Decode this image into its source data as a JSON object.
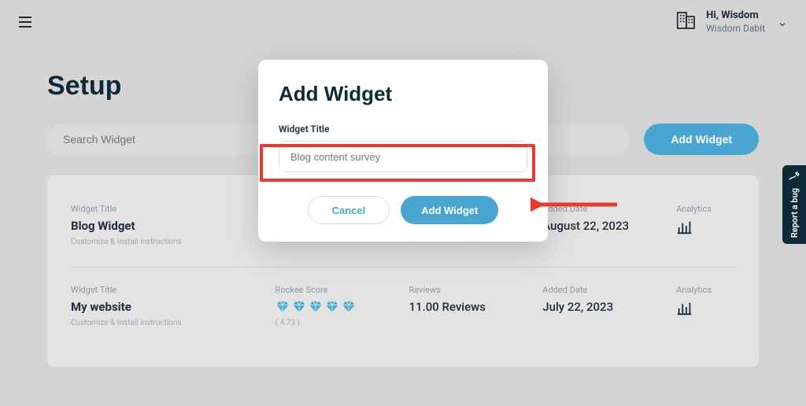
{
  "header": {
    "greeting": "Hi, Wisdom",
    "user_name": "Wisdom Dabit"
  },
  "page": {
    "title": "Setup",
    "search_placeholder": "Search Widget",
    "add_widget_button": "Add Widget"
  },
  "widgets": [
    {
      "title_label": "Widget Title",
      "title": "Blog Widget",
      "sub": "Customize & Install instructions",
      "score_label": "",
      "score": "",
      "score_num": "",
      "reviews_label": "",
      "reviews": "",
      "date_label": "Added Date",
      "date": "August 22, 2023",
      "analytics_label": "Analytics"
    },
    {
      "title_label": "Widget Title",
      "title": "My website",
      "sub": "Customize & Install instructions",
      "score_label": "Rockee Score",
      "score_num": "( 4.73 )",
      "reviews_label": "Reviews",
      "reviews": "11.00 Reviews",
      "date_label": "Added Date",
      "date": "July 22, 2023",
      "analytics_label": "Analytics"
    }
  ],
  "modal": {
    "title": "Add Widget",
    "field_label": "Widget Title",
    "placeholder": "Blog content survey",
    "cancel": "Cancel",
    "submit": "Add Widget"
  },
  "bug": {
    "label": "Report a bug"
  },
  "colors": {
    "accent": "#4aa6d1",
    "highlight": "#e63b2e"
  }
}
